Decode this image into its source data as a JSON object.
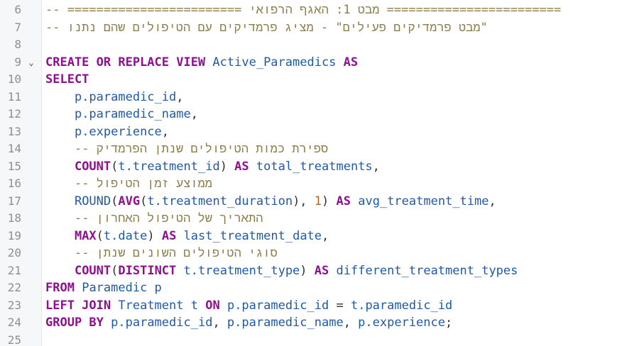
{
  "editor": {
    "lines": [
      {
        "no": "6",
        "fold": false,
        "indent": "",
        "tokens": [
          {
            "t": "cmt",
            "v": "-- ======================== מבט 1: האגף הרפואי ========================"
          }
        ]
      },
      {
        "no": "7",
        "fold": false,
        "indent": "",
        "tokens": [
          {
            "t": "cmt",
            "v": "-- מבט פרמדיקים פעילים\" - מציג פרמדיקים עם הטיפולים שהם נתנו\""
          }
        ]
      },
      {
        "no": "8",
        "fold": false,
        "indent": "",
        "tokens": []
      },
      {
        "no": "9",
        "fold": true,
        "indent": "",
        "tokens": [
          {
            "t": "kw",
            "v": "CREATE OR REPLACE VIEW"
          },
          {
            "t": "plain",
            "v": " "
          },
          {
            "t": "id",
            "v": "Active_Paramedics"
          },
          {
            "t": "plain",
            "v": " "
          },
          {
            "t": "kw",
            "v": "AS"
          }
        ]
      },
      {
        "no": "10",
        "fold": false,
        "indent": "",
        "tokens": [
          {
            "t": "kw",
            "v": "SELECT"
          }
        ]
      },
      {
        "no": "11",
        "fold": false,
        "indent": "    ",
        "tokens": [
          {
            "t": "id",
            "v": "p.paramedic_id"
          },
          {
            "t": "plain",
            "v": ","
          }
        ]
      },
      {
        "no": "12",
        "fold": false,
        "indent": "    ",
        "tokens": [
          {
            "t": "id",
            "v": "p.paramedic_name"
          },
          {
            "t": "plain",
            "v": ","
          }
        ]
      },
      {
        "no": "13",
        "fold": false,
        "indent": "    ",
        "tokens": [
          {
            "t": "id",
            "v": "p.experience"
          },
          {
            "t": "plain",
            "v": ","
          }
        ]
      },
      {
        "no": "14",
        "fold": false,
        "indent": "    ",
        "tokens": [
          {
            "t": "cmt",
            "v": "-- ספירת כמות הטיפולים שנתן הפרמדיק"
          }
        ]
      },
      {
        "no": "15",
        "fold": false,
        "indent": "    ",
        "tokens": [
          {
            "t": "fn",
            "v": "COUNT"
          },
          {
            "t": "plain",
            "v": "("
          },
          {
            "t": "id",
            "v": "t.treatment_id"
          },
          {
            "t": "plain",
            "v": ") "
          },
          {
            "t": "kw",
            "v": "AS"
          },
          {
            "t": "plain",
            "v": " "
          },
          {
            "t": "id",
            "v": "total_treatments"
          },
          {
            "t": "plain",
            "v": ","
          }
        ]
      },
      {
        "no": "16",
        "fold": false,
        "indent": "    ",
        "tokens": [
          {
            "t": "cmt",
            "v": "-- ממוצע זמן הטיפול"
          }
        ]
      },
      {
        "no": "17",
        "fold": false,
        "indent": "    ",
        "tokens": [
          {
            "t": "id",
            "v": "ROUND"
          },
          {
            "t": "plain",
            "v": "("
          },
          {
            "t": "fn",
            "v": "AVG"
          },
          {
            "t": "plain",
            "v": "("
          },
          {
            "t": "id",
            "v": "t.treatment_duration"
          },
          {
            "t": "plain",
            "v": "), "
          },
          {
            "t": "num",
            "v": "1"
          },
          {
            "t": "plain",
            "v": ") "
          },
          {
            "t": "kw",
            "v": "AS"
          },
          {
            "t": "plain",
            "v": " "
          },
          {
            "t": "id",
            "v": "avg_treatment_time"
          },
          {
            "t": "plain",
            "v": ","
          }
        ]
      },
      {
        "no": "18",
        "fold": false,
        "indent": "    ",
        "tokens": [
          {
            "t": "cmt",
            "v": "-- התאריך של הטיפול האחרון"
          }
        ]
      },
      {
        "no": "19",
        "fold": false,
        "indent": "    ",
        "tokens": [
          {
            "t": "fn",
            "v": "MAX"
          },
          {
            "t": "plain",
            "v": "("
          },
          {
            "t": "id",
            "v": "t.date"
          },
          {
            "t": "plain",
            "v": ") "
          },
          {
            "t": "kw",
            "v": "AS"
          },
          {
            "t": "plain",
            "v": " "
          },
          {
            "t": "id",
            "v": "last_treatment_date"
          },
          {
            "t": "plain",
            "v": ","
          }
        ]
      },
      {
        "no": "20",
        "fold": false,
        "indent": "    ",
        "tokens": [
          {
            "t": "cmt",
            "v": "-- סוגי הטיפולים השונים שנתן"
          }
        ]
      },
      {
        "no": "21",
        "fold": false,
        "indent": "    ",
        "tokens": [
          {
            "t": "fn",
            "v": "COUNT"
          },
          {
            "t": "plain",
            "v": "("
          },
          {
            "t": "kw",
            "v": "DISTINCT"
          },
          {
            "t": "plain",
            "v": " "
          },
          {
            "t": "id",
            "v": "t.treatment_type"
          },
          {
            "t": "plain",
            "v": ") "
          },
          {
            "t": "kw",
            "v": "AS"
          },
          {
            "t": "plain",
            "v": " "
          },
          {
            "t": "id",
            "v": "different_treatment_types"
          }
        ]
      },
      {
        "no": "22",
        "fold": false,
        "indent": "",
        "tokens": [
          {
            "t": "kw",
            "v": "FROM"
          },
          {
            "t": "plain",
            "v": " "
          },
          {
            "t": "id",
            "v": "Paramedic p"
          }
        ]
      },
      {
        "no": "23",
        "fold": false,
        "indent": "",
        "tokens": [
          {
            "t": "kw",
            "v": "LEFT JOIN"
          },
          {
            "t": "plain",
            "v": " "
          },
          {
            "t": "id",
            "v": "Treatment t"
          },
          {
            "t": "plain",
            "v": " "
          },
          {
            "t": "kw",
            "v": "ON"
          },
          {
            "t": "plain",
            "v": " "
          },
          {
            "t": "id",
            "v": "p.paramedic_id"
          },
          {
            "t": "plain",
            "v": " = "
          },
          {
            "t": "id",
            "v": "t.paramedic_id"
          }
        ]
      },
      {
        "no": "24",
        "fold": false,
        "indent": "",
        "tokens": [
          {
            "t": "kw",
            "v": "GROUP BY"
          },
          {
            "t": "plain",
            "v": " "
          },
          {
            "t": "id",
            "v": "p.paramedic_id"
          },
          {
            "t": "plain",
            "v": ", "
          },
          {
            "t": "id",
            "v": "p.paramedic_name"
          },
          {
            "t": "plain",
            "v": ", "
          },
          {
            "t": "id",
            "v": "p.experience"
          },
          {
            "t": "plain",
            "v": ";"
          }
        ]
      },
      {
        "no": "25",
        "fold": false,
        "indent": "",
        "tokens": []
      }
    ],
    "fold_icon": "chevron-down-icon",
    "colors": {
      "keyword": "#8f0f8f",
      "identifier": "#1f5aa8",
      "number": "#b5651d",
      "comment": "#8c7d4a",
      "gutter": "#f6f7f9"
    }
  }
}
